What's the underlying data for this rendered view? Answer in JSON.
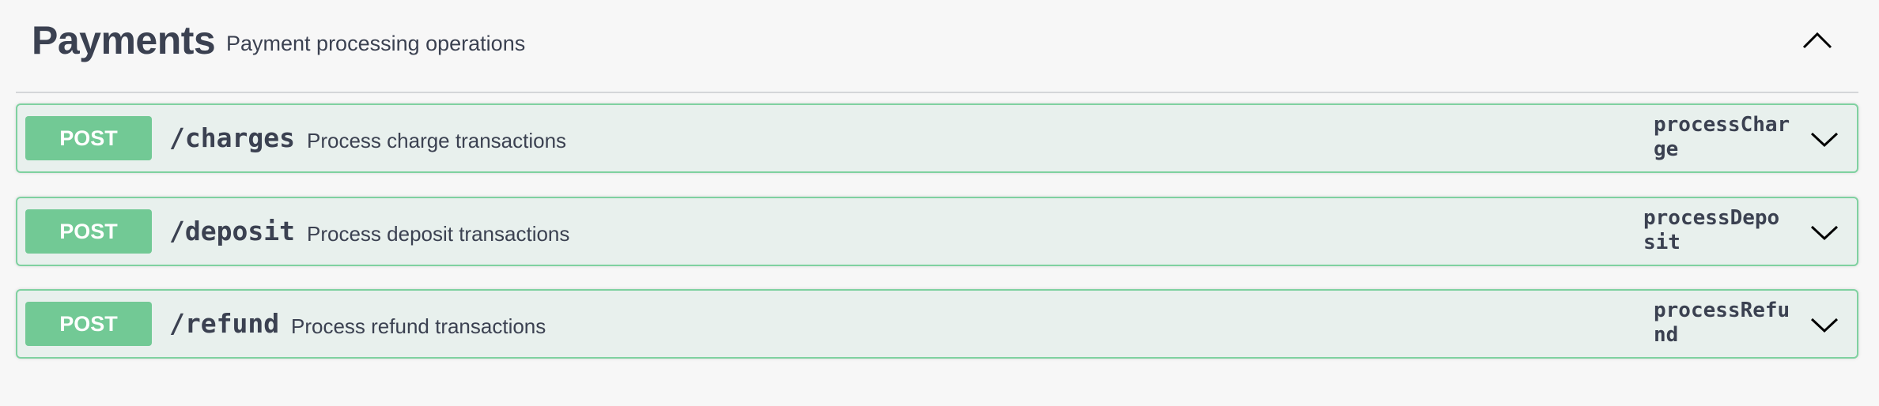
{
  "section": {
    "title": "Payments",
    "description": "Payment processing operations"
  },
  "operations": [
    {
      "method": "POST",
      "path": "/charges",
      "summary": "Process charge transactions",
      "operation_id": "processCharge"
    },
    {
      "method": "POST",
      "path": "/deposit",
      "summary": "Process deposit transactions",
      "operation_id": "processDeposit"
    },
    {
      "method": "POST",
      "path": "/refund",
      "summary": "Process refund transactions",
      "operation_id": "processRefund"
    }
  ],
  "icons": {
    "collapse": "chevron-up-icon",
    "expand": "chevron-down-icon"
  },
  "colors": {
    "post_badge": "#72c995",
    "post_border": "#7fd1a0",
    "post_background": "#e8f0ed",
    "text": "#3b4151"
  }
}
